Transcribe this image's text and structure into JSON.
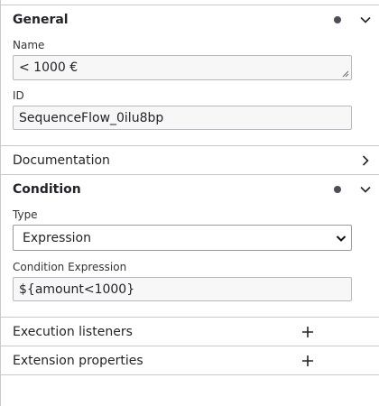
{
  "general": {
    "title": "General",
    "name_label": "Name",
    "name_value": "< 1000 €",
    "id_label": "ID",
    "id_value": "SequenceFlow_0ilu8bp"
  },
  "documentation": {
    "title": "Documentation"
  },
  "condition": {
    "title": "Condition",
    "type_label": "Type",
    "type_value": "Expression",
    "expression_label": "Condition Expression",
    "expression_value": "${amount<1000}"
  },
  "execution_listeners": {
    "title": "Execution listeners"
  },
  "extension_properties": {
    "title": "Extension properties"
  },
  "icons": {
    "status_dot": "status-dot-icon",
    "collapse": "chevron-down-icon",
    "expand": "chevron-right-icon",
    "add": "plus-icon"
  },
  "colors": {
    "border": "#c8c8d0",
    "field_bg": "#f7f7f8",
    "text": "#22242a"
  }
}
